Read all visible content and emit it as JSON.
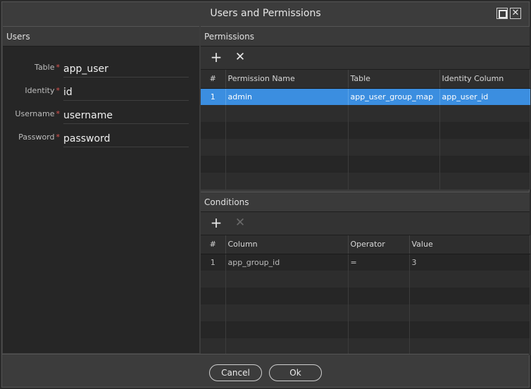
{
  "window": {
    "title": "Users and Permissions",
    "close_glyph": "✕"
  },
  "users": {
    "header": "Users",
    "fields": [
      {
        "label": "Table",
        "value": "app_user"
      },
      {
        "label": "Identity",
        "value": "id"
      },
      {
        "label": "Username",
        "value": "username"
      },
      {
        "label": "Password",
        "value": "password"
      }
    ],
    "required_mark": "*"
  },
  "permissions": {
    "header": "Permissions",
    "toolbar": {
      "add": "+",
      "remove": "✕"
    },
    "columns": [
      "#",
      "Permission Name",
      "Table",
      "Identity Column"
    ],
    "rows": [
      {
        "num": "1",
        "name": "admin",
        "table": "app_user_group_map",
        "identity": "app_user_id"
      }
    ]
  },
  "conditions": {
    "header": "Conditions",
    "toolbar": {
      "add": "+",
      "remove": "✕"
    },
    "columns": [
      "#",
      "Column",
      "Operator",
      "Value"
    ],
    "rows": [
      {
        "num": "1",
        "column": "app_group_id",
        "operator": "=",
        "value": "3"
      }
    ]
  },
  "footer": {
    "cancel": "Cancel",
    "ok": "Ok"
  },
  "colors": {
    "selection": "#3b8ee0",
    "required": "#d9534f",
    "background": "#2b2b2b"
  }
}
